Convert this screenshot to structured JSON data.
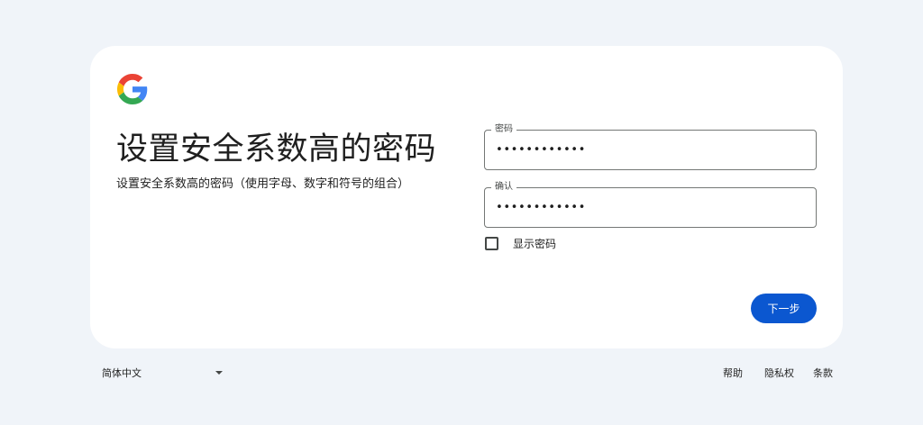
{
  "logo": {
    "icon": "google-g-icon",
    "colors": {
      "blue": "#4285F4",
      "red": "#EA4335",
      "yellow": "#FBBC05",
      "green": "#34A853"
    }
  },
  "heading": {
    "title": "设置安全系数高的密码",
    "subtitle": "设置安全系数高的密码（使用字母、数字和符号的组合）"
  },
  "form": {
    "password": {
      "label": "密码",
      "value": "••••••••••••"
    },
    "confirm": {
      "label": "确认",
      "value": "••••••••••••"
    },
    "show_password": {
      "label": "显示密码",
      "checked": false
    },
    "next_label": "下一步"
  },
  "footer": {
    "language": "简体中文",
    "links": {
      "help": "帮助",
      "privacy": "隐私权",
      "terms": "条款"
    }
  },
  "colors": {
    "primary": "#0b57d0",
    "background": "#f0f4f9",
    "card": "#ffffff"
  }
}
